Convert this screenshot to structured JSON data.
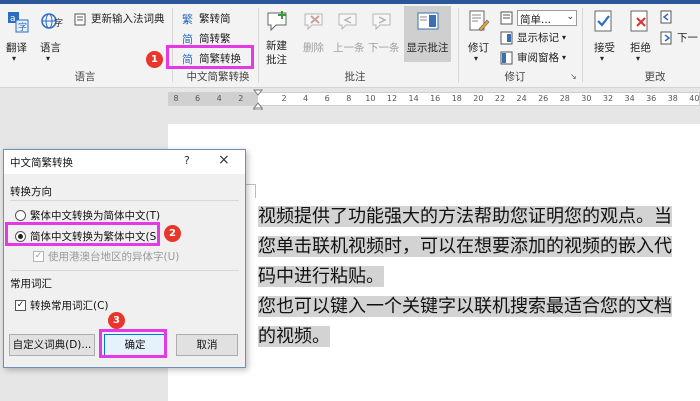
{
  "ribbon": {
    "language_group": {
      "translate": "翻译",
      "language": "语言",
      "update_ime": "更新输入法词典",
      "label": "语言"
    },
    "chinese_conversion_group": {
      "trad_to_simp": "繁转简",
      "simp_to_trad": "简转繁",
      "conversion": "简繁转换",
      "label": "中文简繁转换"
    },
    "comments_group": {
      "new_comment_line1": "新建",
      "new_comment_line2": "批注",
      "delete": "删除",
      "previous": "上一条",
      "next": "下一条",
      "show_comments": "显示批注",
      "label": "批注"
    },
    "tracking_group": {
      "track_changes": "修订",
      "display_mode": "简单...",
      "show_markup": "显示标记",
      "reviewing_pane": "审阅窗格",
      "label": "修订"
    },
    "changes_group": {
      "accept": "接受",
      "reject": "拒绝",
      "next": "下一",
      "label": "更改"
    }
  },
  "ruler": {
    "ticks": [
      "8",
      "6",
      "4",
      "2",
      "",
      "2",
      "4",
      "6",
      "8",
      "10",
      "12",
      "14",
      "16",
      "18",
      "20",
      "22",
      "24",
      "26",
      "28",
      "30",
      "32",
      "34",
      "36",
      "38",
      "40"
    ]
  },
  "document": {
    "lines": [
      "视频提供了功能强大的方法帮助您证明您的观点。当",
      "您单击联机视频时，可以在想要添加的视频的嵌入代",
      "码中进行粘贴。",
      "您也可以键入一个关键字以联机搜索最适合您的文档",
      "的视频。"
    ]
  },
  "dialog": {
    "title": "中文简繁转换",
    "help": "?",
    "close": "×",
    "direction_label": "转换方向",
    "option_trad_to_simp": "繁体中文转换为简体中文(T)",
    "option_simp_to_trad": "简体中文转换为繁体中文(S)",
    "option_hk_variants": "使用港澳台地区的异体字(U)",
    "common_terms_label": "常用词汇",
    "convert_common_terms": "转换常用词汇(C)",
    "custom_dictionary": "自定义词典(D)...",
    "ok": "确定",
    "cancel": "取消"
  },
  "annotations": {
    "badge1": "1",
    "badge2": "2",
    "badge3": "3",
    "highlight_color": "#e639e6",
    "badge_color": "#e8372a"
  }
}
